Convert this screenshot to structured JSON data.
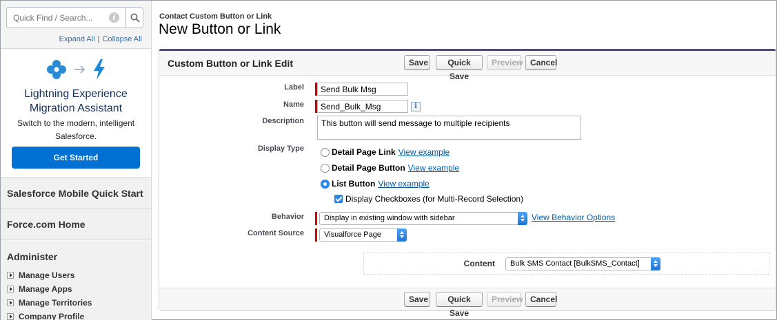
{
  "sidebar": {
    "search_placeholder": "Quick Find / Search...",
    "expand_all": "Expand All",
    "separator": "|",
    "collapse_all": "Collapse All",
    "migration": {
      "title_line1": "Lightning Experience",
      "title_line2": "Migration Assistant",
      "subtitle": "Switch to the modern, intelligent Salesforce.",
      "button": "Get Started"
    },
    "sections": [
      "Salesforce Mobile Quick Start",
      "Force.com Home"
    ],
    "administer": {
      "title": "Administer",
      "items": [
        "Manage Users",
        "Manage Apps",
        "Manage Territories",
        "Company Profile"
      ]
    }
  },
  "header": {
    "breadcrumb": "Contact Custom Button or Link",
    "title": "New Button or Link"
  },
  "panel": {
    "title": "Custom Button or Link Edit",
    "buttons": {
      "save": "Save",
      "quick_save": "Quick Save",
      "preview": "Preview",
      "cancel": "Cancel"
    },
    "form": {
      "label_label": "Label",
      "label_value": "Send Bulk Msg",
      "name_label": "Name",
      "name_value": "Send_Bulk_Msg",
      "description_label": "Description",
      "description_value": "This button will send message to multiple recipients",
      "display_type_label": "Display Type",
      "display_options": [
        {
          "label": "Detail Page Link",
          "link": "View example",
          "selected": false
        },
        {
          "label": "Detail Page Button",
          "link": "View example",
          "selected": false
        },
        {
          "label": "List Button",
          "link": "View example",
          "selected": true
        }
      ],
      "checkbox_label": "Display Checkboxes (for Multi-Record Selection)",
      "behavior_label": "Behavior",
      "behavior_value": "Display in existing window with sidebar",
      "behavior_link": "View Behavior Options",
      "content_source_label": "Content Source",
      "content_source_value": "Visualforce Page",
      "content_label": "Content",
      "content_value": "Bulk SMS Contact [BulkSMS_Contact]"
    }
  }
}
